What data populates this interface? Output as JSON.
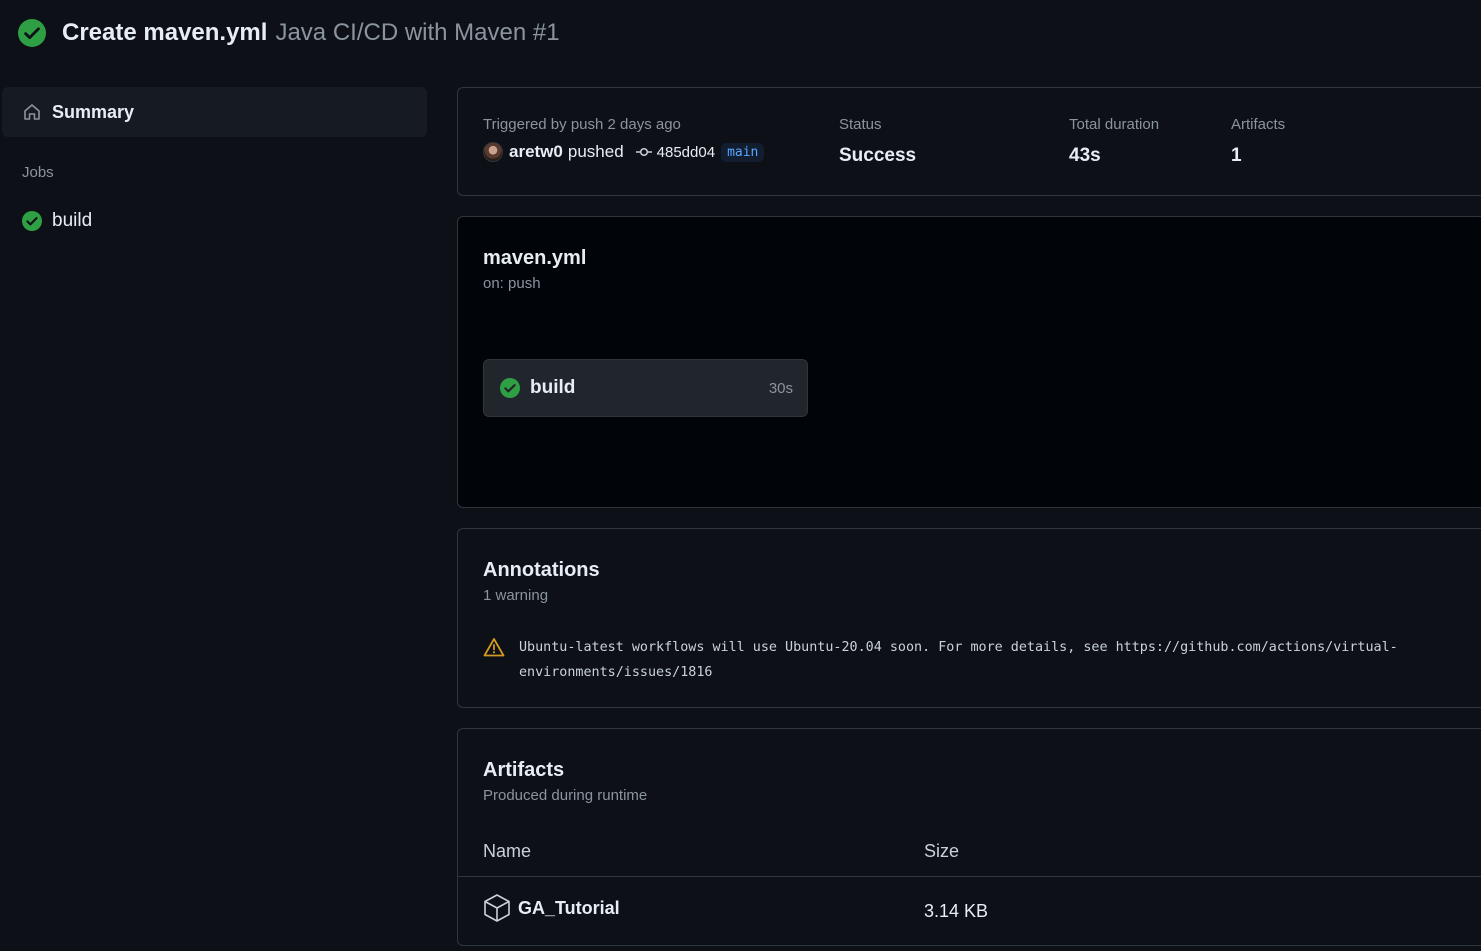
{
  "header": {
    "title": "Create maven.yml",
    "workflow": "Java CI/CD with Maven #1",
    "status_color": "#2ea043"
  },
  "sidebar": {
    "summary_label": "Summary",
    "jobs_label": "Jobs",
    "jobs": [
      {
        "label": "build",
        "status": "success"
      }
    ]
  },
  "summary": {
    "trigger_label": "Triggered by push 2 days ago",
    "actor": "aretw0",
    "action": "pushed",
    "commit_sha": "485dd04",
    "branch": "main",
    "status_label": "Status",
    "status_value": "Success",
    "duration_label": "Total duration",
    "duration_value": "43s",
    "artifacts_label": "Artifacts",
    "artifacts_value": "1"
  },
  "graph": {
    "file": "maven.yml",
    "trigger": "on: push",
    "job_name": "build",
    "job_duration": "30s"
  },
  "annotations": {
    "title": "Annotations",
    "count": "1 warning",
    "warning_text": "Ubuntu-latest workflows will use Ubuntu-20.04 soon. For more details, see https://github.com/actions/virtual-environments/issues/1816",
    "warning_color": "#d29922"
  },
  "artifacts": {
    "title": "Artifacts",
    "subtitle": "Produced during runtime",
    "columns": [
      "Name",
      "Size"
    ],
    "rows": [
      {
        "name": "GA_Tutorial",
        "size": "3.14 KB"
      }
    ]
  }
}
